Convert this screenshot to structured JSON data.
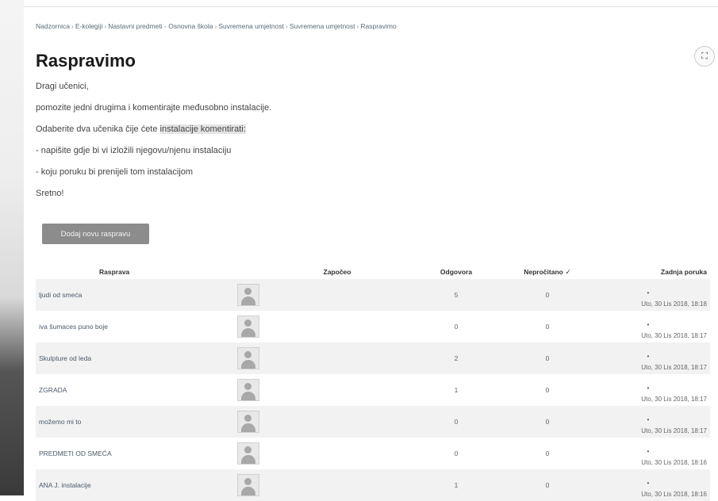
{
  "breadcrumb": [
    "Nadzornica",
    "E-kolegiji",
    "Nastavni predmeti - Osnovna škola",
    "Suvremena umjetnost",
    "Suvremena umjetnost",
    "Raspravimo"
  ],
  "breadcrumb_separator": "›",
  "fullscreen_icon_glyph": "⛶",
  "page_title": "Raspravimo",
  "intro": {
    "greeting": "Dragi učenici,",
    "line1": "pomozite jedni drugima i komentirajte međusobno instalacije.",
    "line2_prefix": "Odaberite dva učenika čije ćete ",
    "line2_highlight": "instalacije komentirati:",
    "bullet1": "- napišite gdje bi vi izložili njegovu/njenu instalaciju",
    "bullet2": "- koju poruku bi prenijeli tom instalacijom",
    "closing": "Sretno!"
  },
  "add_button_label": "Dodaj novu raspravu",
  "table": {
    "headers": {
      "discussion": "Rasprava",
      "started_by": "Započeo",
      "replies": "Odgovora",
      "unread": "Nepročitano",
      "unread_icon": "✓",
      "last_post": "Zadnja poruka"
    },
    "rows": [
      {
        "title": "ljudi od smeća",
        "replies": "5",
        "unread": "0",
        "last_post": "Uto, 30 Lis 2018, 18:18"
      },
      {
        "title": "iva šumaces puno boje",
        "replies": "0",
        "unread": "0",
        "last_post": "Uto, 30 Lis 2018, 18:17"
      },
      {
        "title": "Skulpture od leda",
        "replies": "2",
        "unread": "0",
        "last_post": "Uto, 30 Lis 2018, 18:17"
      },
      {
        "title": "ZGRADA",
        "replies": "1",
        "unread": "0",
        "last_post": "Uto, 30 Lis 2018, 18:17"
      },
      {
        "title": "možemo mi to",
        "replies": "0",
        "unread": "0",
        "last_post": "Uto, 30 Lis 2018, 18:17"
      },
      {
        "title": "PREDMETI OD SMEĆA",
        "replies": "0",
        "unread": "0",
        "last_post": "Uto, 30 Lis 2018, 18:16"
      },
      {
        "title": "ANA J. instalacije",
        "replies": "1",
        "unread": "0",
        "last_post": "Uto, 30 Lis 2018, 18:16"
      }
    ]
  },
  "colors": {
    "button_bg": "#8c8c8c",
    "row_stripe": "#f2f2f2",
    "link_text": "#4a5a6a"
  }
}
